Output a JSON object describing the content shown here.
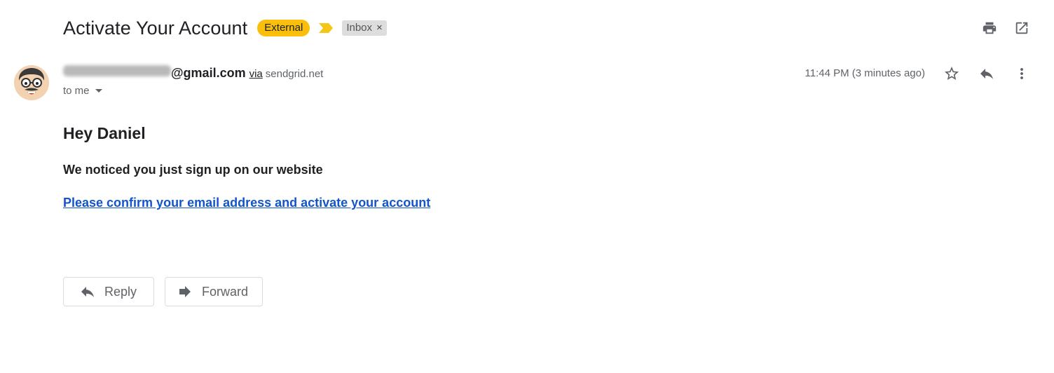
{
  "email": {
    "subject": "Activate Your Account",
    "external_badge": "External",
    "label_chip": "Inbox",
    "label_remove": "×",
    "sender_email_suffix": "@gmail.com",
    "via": "via",
    "via_domain": "sendgrid.net",
    "recipient": "to me",
    "timestamp": "11:44 PM (3 minutes ago)",
    "greeting": "Hey Daniel",
    "body_line": "We noticed you just sign up on our website",
    "confirm_link": "Please confirm your email address and activate your account"
  },
  "actions": {
    "reply_label": "Reply",
    "forward_label": "Forward"
  },
  "icons": {
    "top": [
      "print-icon",
      "open-in-new-window-icon"
    ],
    "sender": [
      "star-icon",
      "reply-icon",
      "more-vert-icon"
    ],
    "importance": "importance-marker-icon"
  },
  "colors": {
    "external_badge_bg": "#f9bf0a",
    "importance_marker": "#f5c518",
    "link": "#1155cc",
    "label_chip_bg": "#dddddd"
  }
}
